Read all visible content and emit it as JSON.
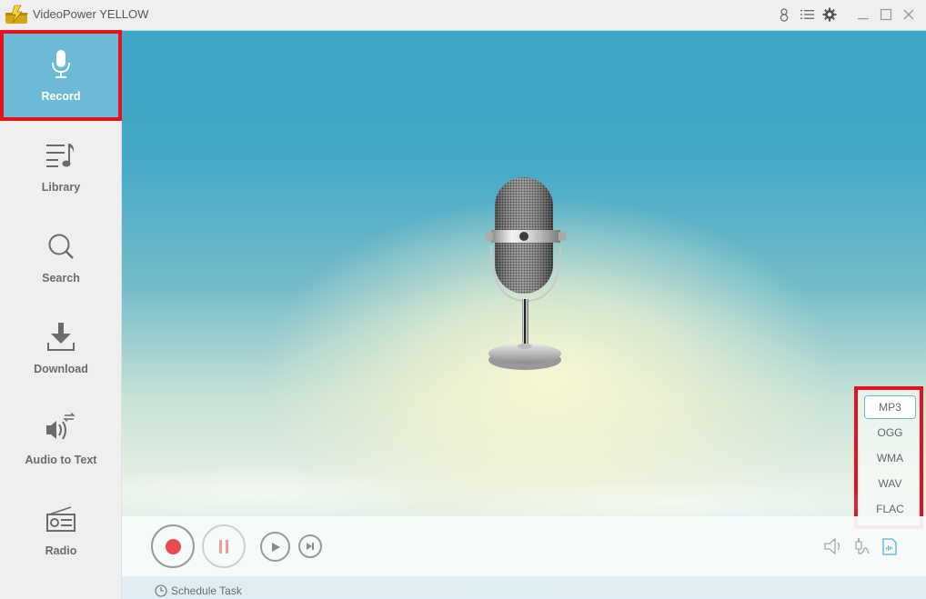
{
  "app": {
    "title": "VideoPower YELLOW",
    "accent_color": "#6dbad6",
    "highlight_color": "#e5121b"
  },
  "titlebar": {
    "icons": [
      "user-icon",
      "menu-list-icon",
      "settings-gear-icon",
      "minimize-icon",
      "maximize-icon",
      "close-icon"
    ]
  },
  "sidebar": {
    "items": [
      {
        "label": "Record",
        "icon": "microphone-icon",
        "active": true
      },
      {
        "label": "Library",
        "icon": "music-list-icon",
        "active": false
      },
      {
        "label": "Search",
        "icon": "search-icon",
        "active": false
      },
      {
        "label": "Download",
        "icon": "download-icon",
        "active": false
      },
      {
        "label": "Audio to Text",
        "icon": "audio-to-text-icon",
        "active": false
      },
      {
        "label": "Radio",
        "icon": "radio-icon",
        "active": false
      }
    ]
  },
  "format_panel": {
    "options": [
      "MP3",
      "OGG",
      "WMA",
      "WAV",
      "FLAC"
    ],
    "selected": "MP3"
  },
  "controls": {
    "record": "record-button",
    "pause": "pause-button",
    "play": "play-button",
    "next": "skip-next-button",
    "right_icons": [
      "system-sound-icon",
      "microphone-input-icon",
      "audio-format-file-icon"
    ]
  },
  "schedule": {
    "label": "Schedule Task"
  }
}
